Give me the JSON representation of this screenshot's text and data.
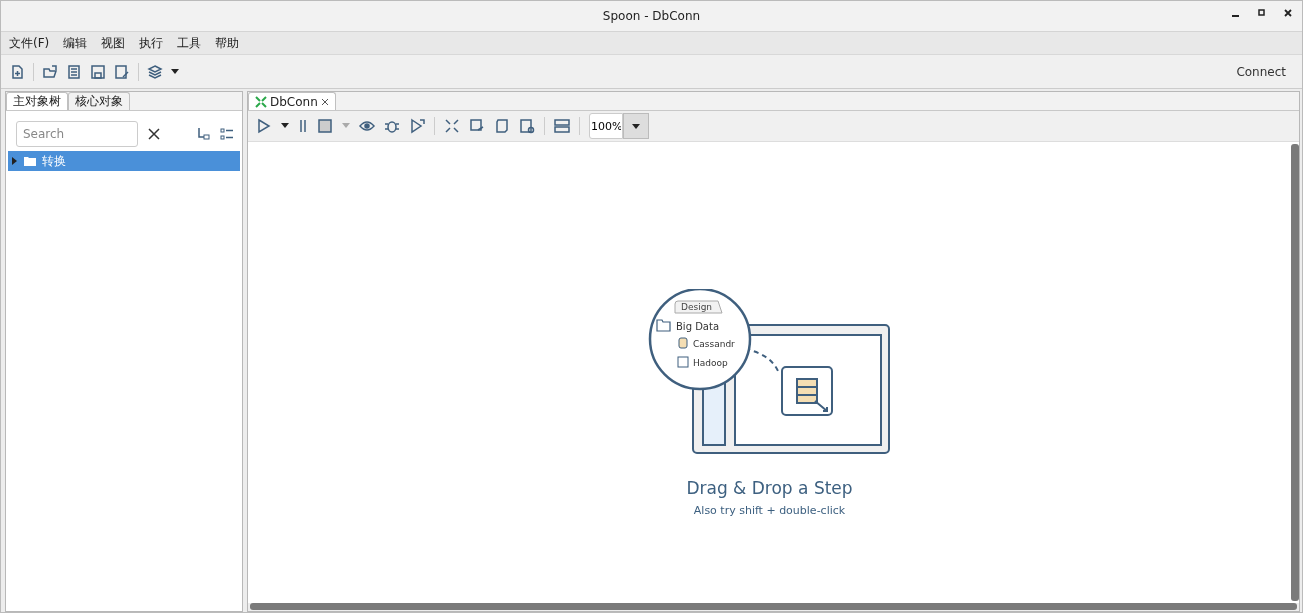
{
  "window": {
    "title": "Spoon - DbConn"
  },
  "menu": [
    "文件(F)",
    "编辑",
    "视图",
    "执行",
    "工具",
    "帮助"
  ],
  "toolbar": {
    "connect": "Connect"
  },
  "left_tabs": [
    {
      "label": "主对象树",
      "selected": true
    },
    {
      "label": "核心对象",
      "selected": false
    }
  ],
  "search": {
    "placeholder": "Search"
  },
  "tree": [
    {
      "label": "转换",
      "selected": true,
      "expanded": false
    }
  ],
  "editor_tabs": [
    {
      "label": "DbConn",
      "selected": true
    }
  ],
  "zoom": {
    "value": "100%"
  },
  "canvas": {
    "illustration": {
      "tab": "Design",
      "folder": "Big Data",
      "items": [
        "Cassandr",
        "Hadoop"
      ]
    },
    "title": "Drag & Drop a Step",
    "hint": "Also try shift + double-click"
  }
}
